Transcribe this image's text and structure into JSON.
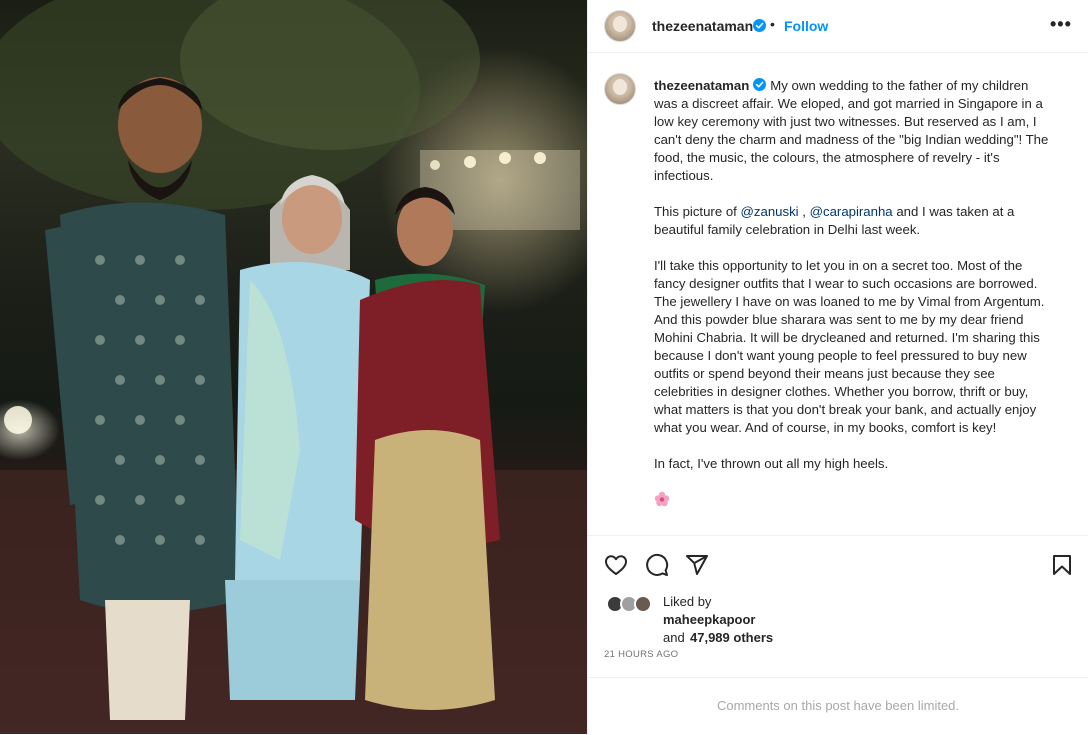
{
  "post": {
    "username": "thezeenataman",
    "follow_label": "Follow",
    "separator": "•",
    "more_label": "•••",
    "caption_paragraphs": [
      "My own wedding to the father of my children was a discreet affair. We eloped, and got married in Singapore in a low key ceremony with just two witnesses. But reserved as I am, I can't deny the charm and madness of the \"big Indian wedding\"! The food, the music, the colours, the atmosphere of revelry - it's infectious."
    ],
    "para2_prefix": "This picture of ",
    "mention1": "@zanuski",
    "para2_mid": " , ",
    "mention2": "@carapiranha",
    "para2_suffix": " and I was taken at a beautiful family celebration in Delhi last week.",
    "para3": "I'll take this opportunity to let you in on a secret too. Most of the fancy designer outfits that I wear to such occasions are borrowed. The jewellery I have on was loaned to me by Vimal from Argentum. And this powder blue sharara was sent to me by my dear friend Mohini Chabria. It will be drycleaned and returned. I'm sharing this because I don't want young people to feel pressured to buy new outfits or spend beyond their means just because they see celebrities in designer clothes. Whether you borrow, thrift or buy, what matters is that you don't break your bank, and actually enjoy what you wear. And of course, in my books, comfort is key!",
    "para4": "In fact, I've thrown out all my high heels."
  },
  "likes": {
    "liked_by_label": "Liked by",
    "liker": "maheepkapoor",
    "and_label": "and",
    "others": "47,989 others"
  },
  "timestamp": "21 HOURS AGO",
  "comments_notice": "Comments on this post have been limited.",
  "icons": [
    "heart-icon",
    "comment-icon",
    "share-icon",
    "bookmark-icon",
    "verified-badge-icon",
    "more-options-icon",
    "flower-emoji-icon"
  ],
  "colors": {
    "link": "#0095f6",
    "mention": "#00376b",
    "text": "#262626",
    "muted": "#737373"
  }
}
